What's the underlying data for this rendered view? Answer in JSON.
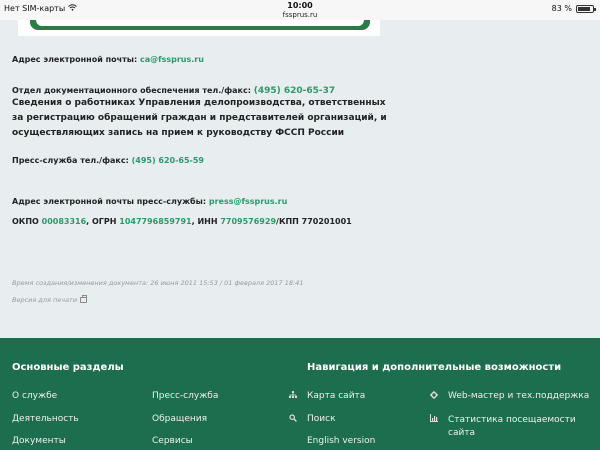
{
  "statusbar": {
    "carrier": "Нет SIM-карты",
    "time": "10:00",
    "url": "fssprus.ru",
    "battery": "83 %",
    "battery_level": 0.83
  },
  "content": {
    "email_label": "Адрес электронной почты:",
    "email_value": "ca@fssprus.ru",
    "docs_label": "Отдел документационного обеспечения тел./факс:",
    "docs_phone": "(495) 620-65-37",
    "info_text": "Сведения о работниках Управления делопроизводства, ответственных за регистрацию обращений граждан и представителей организаций, и осуществляющих запись на прием к руководству ФССП России",
    "press_label": "Пресс-служба тел./факс:",
    "press_phone": "(495) 620-65-59",
    "press_email_label": "Адрес электронной почты пресс-службы:",
    "press_email_value": "press@fssprus.ru",
    "okpo_label": "ОКПО",
    "okpo_value": "00083316",
    "ogrn_label": ", ОГРН",
    "ogrn_value": "1047796859791",
    "inn_label": ", ИНН",
    "inn_value": "7709576929",
    "kpp_text": "/КПП 770201001",
    "meta_text": "Время создания/изменения документа: 26 июня 2011 15:53 / 01 февраля 2017 18:41",
    "print_text": "Версия для печати"
  },
  "footer": {
    "col1_title": "Основные разделы",
    "col1_links": [
      "О службе",
      "Деятельность",
      "Документы"
    ],
    "col2_links": [
      "Пресс-служба",
      "Обращения",
      "Сервисы"
    ],
    "col3_title": "Навигация и дополнительные возможности",
    "col3_links": [
      "Карта сайта",
      "Поиск",
      "English version"
    ],
    "col4_links": [
      "Web-мастер и тех.поддержка",
      "Статистика посещаемости сайта"
    ]
  },
  "colors": {
    "link_green": "#2b9a6a",
    "footer_bg": "#1d6e4e"
  }
}
